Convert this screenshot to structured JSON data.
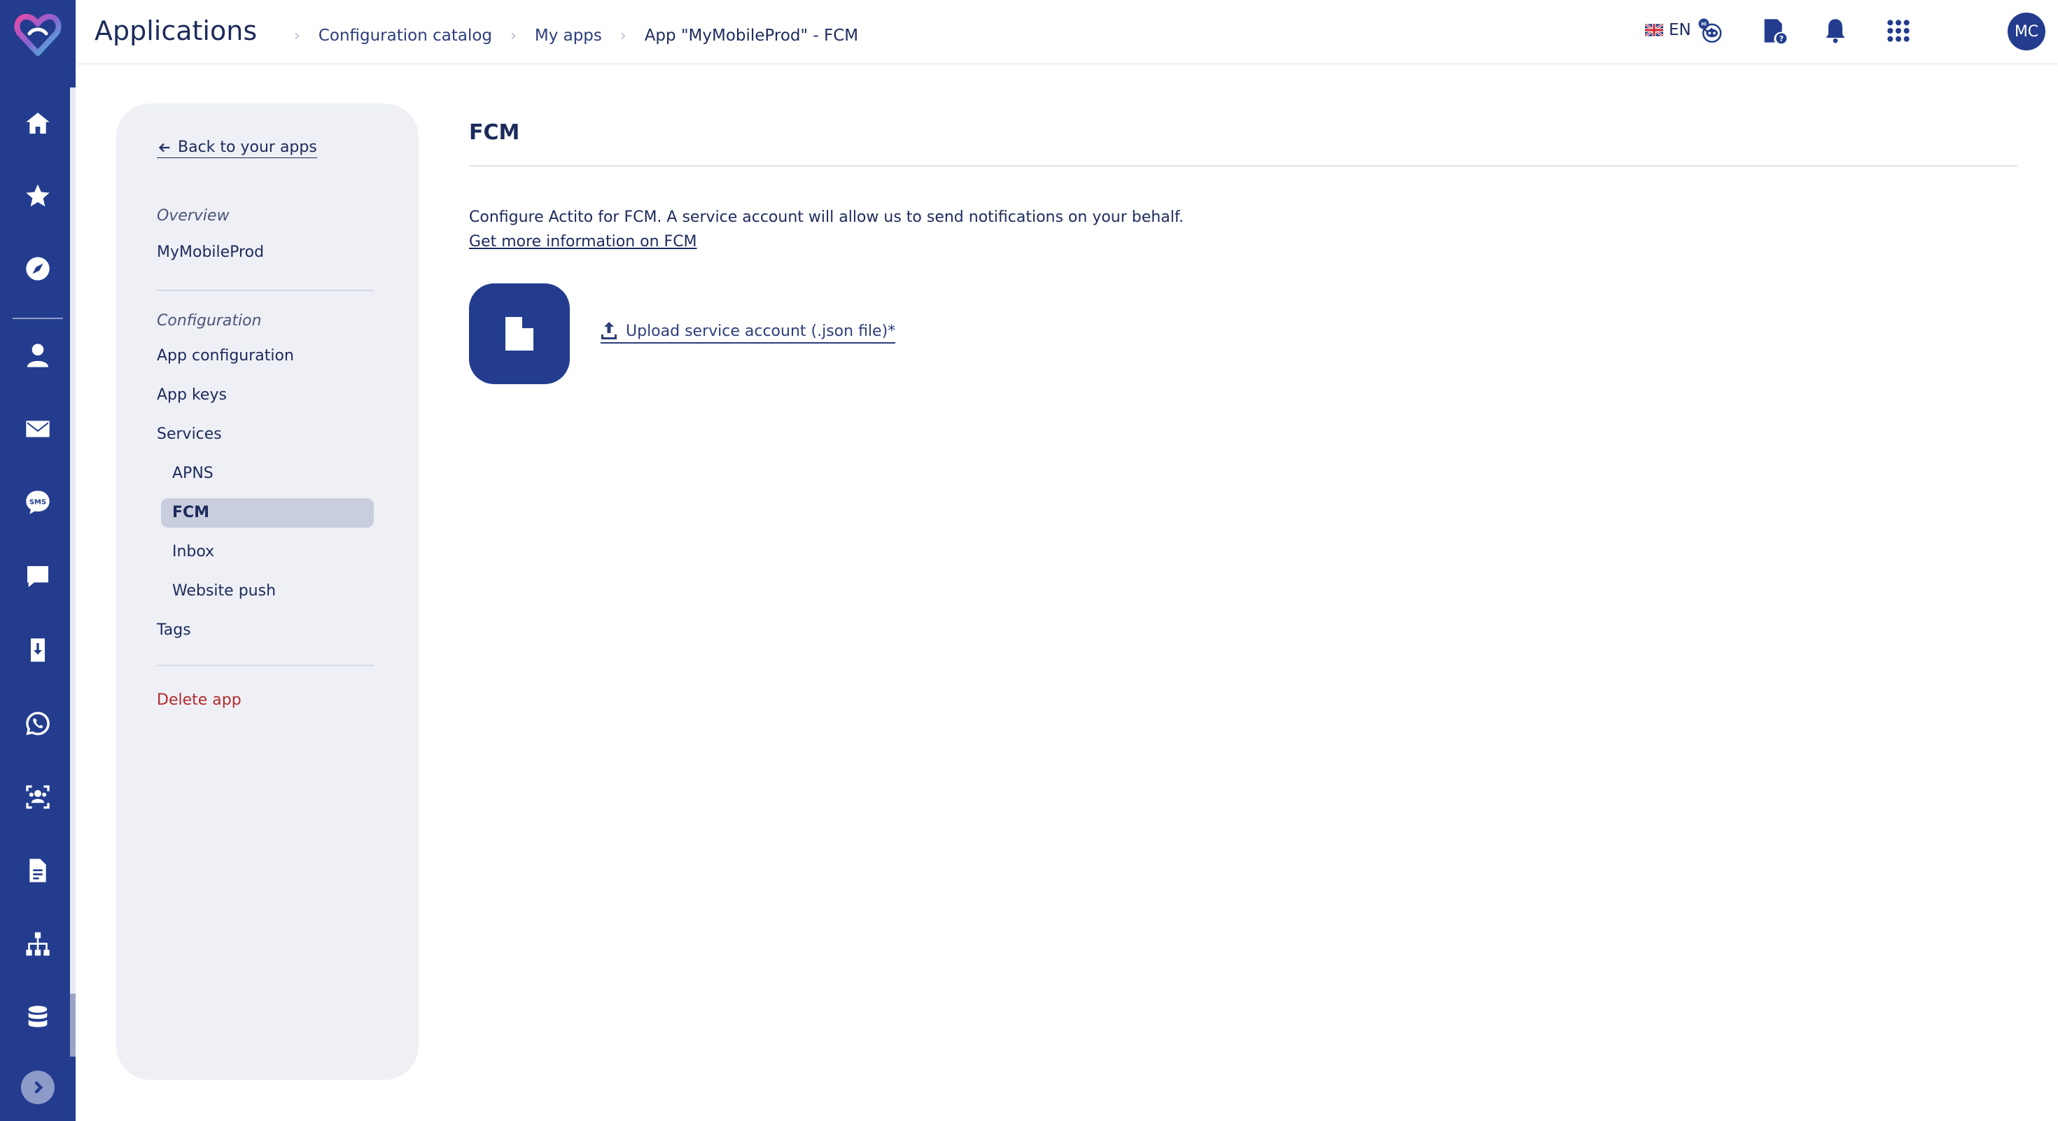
{
  "header": {
    "app_title": "Applications",
    "breadcrumbs": [
      "Configuration catalog",
      "My apps",
      "App \"MyMobileProd\" - FCM"
    ],
    "language": "EN",
    "avatar_initials": "MC"
  },
  "rail": {
    "icons": [
      "home-icon",
      "star-icon",
      "compass-icon",
      "person-icon",
      "mail-icon",
      "sms-icon",
      "chat-icon",
      "mobile-push-icon",
      "whatsapp-icon",
      "audience-icon",
      "document-icon",
      "hierarchy-icon",
      "database-icon"
    ]
  },
  "sidebar": {
    "back_label": "Back to your apps",
    "overview_label": "Overview",
    "app_name": "MyMobileProd",
    "configuration_label": "Configuration",
    "items": {
      "app_configuration": "App configuration",
      "app_keys": "App keys",
      "services": "Services",
      "apns": "APNS",
      "fcm": "FCM",
      "inbox": "Inbox",
      "website_push": "Website push",
      "tags": "Tags"
    },
    "delete_label": "Delete app"
  },
  "main": {
    "title": "FCM",
    "description": "Configure Actito for FCM. A service account will allow us to send notifications on your behalf.",
    "info_link": "Get more information on FCM",
    "upload_label": "Upload service account (.json file)*"
  },
  "colors": {
    "brand_navy": "#233c8e",
    "text_dark": "#1d2a5b",
    "panel_bg": "#eef0f6",
    "active_pill": "#c9cedf",
    "danger": "#b22a2a"
  }
}
